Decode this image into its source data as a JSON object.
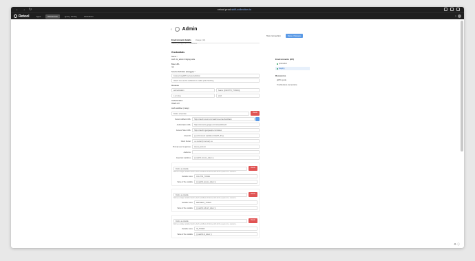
{
  "browser": {
    "url_prefix": "retool.prod.",
    "url_domain": "skill-collection.io",
    "nav_back": "←",
    "nav_forward": "→",
    "nav_reload": "↻"
  },
  "app": {
    "logo_text": "Retool",
    "nav": [
      "Apps",
      "Resources",
      "Query Library",
      "Workflows"
    ],
    "help": "?"
  },
  "header": {
    "back": "‹",
    "title": "Admin",
    "buttons": [
      "Test connection",
      "Save changes"
    ],
    "tabs": [
      "Environment details",
      "Usage (11)"
    ],
    "subtext": "Used by 11 apps and 0 workflows"
  },
  "form": {
    "section_title": "Credentials",
    "name_label": "Name *",
    "name_value": "Auth: Gl_admin bridging table",
    "base_url_label": "Base URL",
    "base_url_value": "n/a",
    "swagger_label": "Service Definition (Swagger) *",
    "swagger_placeholder": "Connect to gRPC service definition",
    "swagger_hint": "Attach one service definition to enable proto fetching.",
    "metadata_label": "Metadata",
    "metadata_rows": [
      {
        "key": "authentication",
        "value": "bearer {{OAUTH2_TOKEN}}"
      },
      {
        "key": "x-env-key",
        "value": "prod"
      }
    ],
    "authentication_label": "Authentication",
    "authentication_value": "OAuth 2.0",
    "auth_section": "Auth workflow (1 step)",
    "auth_type_value": "Define a function",
    "delete_label": "Delete",
    "fields": [
      {
        "key": "Retool callback URL",
        "value": "https://oauth.retool.com/oauth/user/oauthcallback"
      },
      {
        "key": "Authorization URL",
        "value": "https://accounts.google.com/o/oauth2/auth"
      },
      {
        "key": "Access Token URL",
        "value": "https://oauth2.googleapis.com/token"
      },
      {
        "key": "Client ID",
        "value": "{{ environment.variables.CLIENT_ID }}"
      },
      {
        "key": "Client Secret",
        "value": "•••• secret (in server) ••••"
      },
      {
        "key": "Prompt user to approve",
        "value": "select_account"
      },
      {
        "key": "Audience",
        "value": ""
      },
      {
        "key": "Exported variables",
        "value": "{{ oauth2.access_token }}"
      }
    ],
    "variables": [
      {
        "label": "Define a variable",
        "hint": "Define a single variable that the Auth workflow will share with all the queries in a resource.",
        "name_key": "Variable name",
        "name_value": "OAUTH2_TOKEN",
        "val_key": "Value of the variable",
        "val_value": "{{ oauth2.access_token }}"
      },
      {
        "label": "Define a variable",
        "hint": "Define a single variable that the Auth workflow will share with all the queries in a resource.",
        "name_key": "Variable name",
        "name_value": "REFRESH_TOKEN",
        "val_key": "Value of the variable",
        "val_value": "{{ oauth2.refresh_token }}"
      },
      {
        "label": "Define a variable",
        "hint": "Define a single variable that the Auth workflow will share with all the queries in a resource.",
        "name_key": "Variable name",
        "name_value": "ID_TOKEN",
        "val_key": "Value of the variable",
        "val_value": "{{ oauth2.id_token }}"
      }
    ]
  },
  "side": {
    "env_title": "Environments (2/3)",
    "envs": [
      "production",
      "staging"
    ],
    "resources_title": "Resources",
    "resources": [
      "gRPC guide",
      "Troubleshoot connections"
    ]
  },
  "footer_icons": "⚙ ⓘ"
}
